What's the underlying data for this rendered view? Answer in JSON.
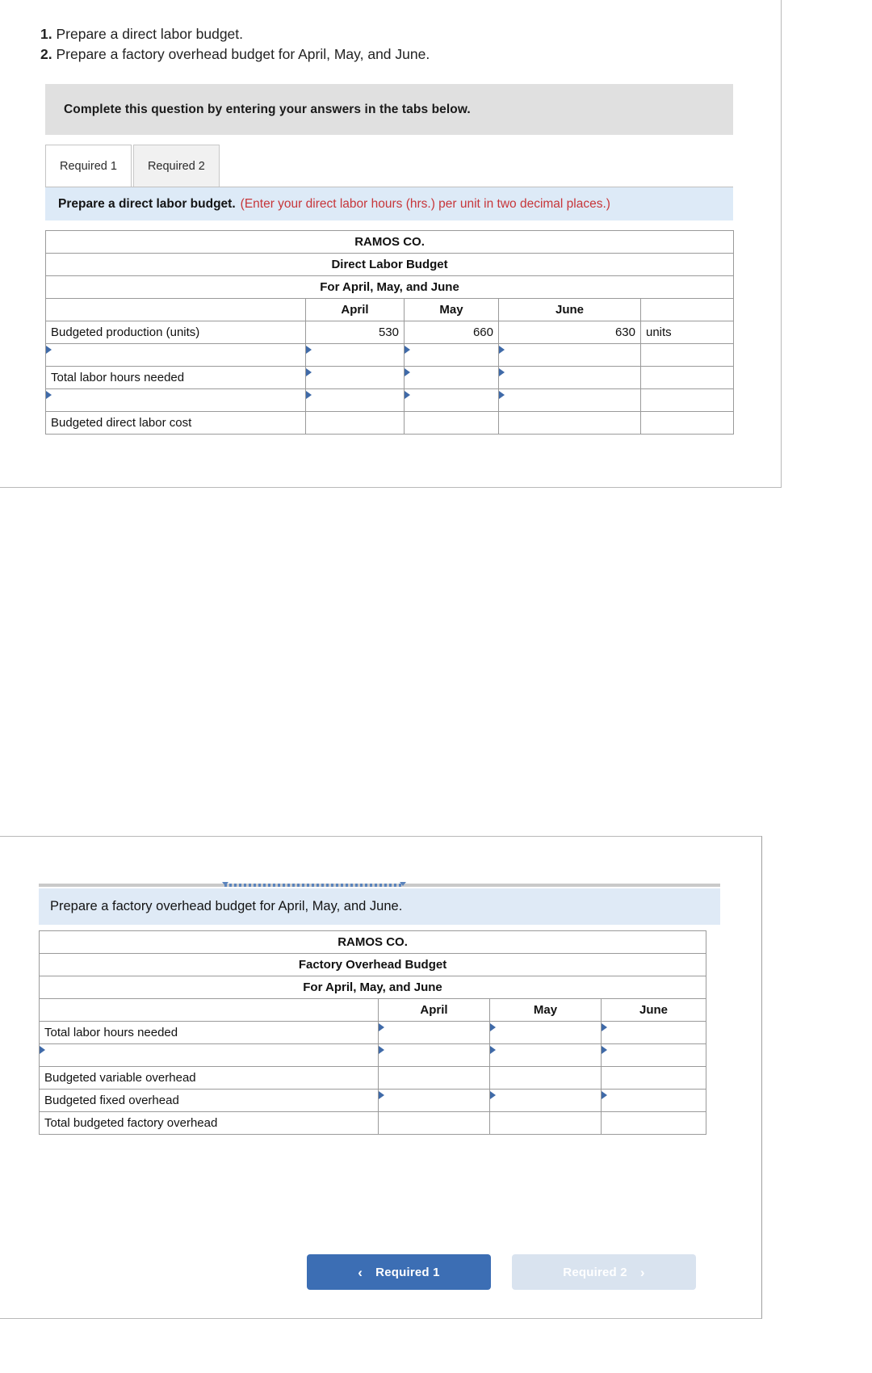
{
  "questions": [
    {
      "num": "1.",
      "text": "Prepare a direct labor budget."
    },
    {
      "num": "2.",
      "text": "Prepare a factory overhead budget for April, May, and June."
    }
  ],
  "gray_banner": {
    "text": "Complete this question by entering your answers in the tabs below."
  },
  "tabs": [
    {
      "label": "Required 1",
      "active": true
    },
    {
      "label": "Required 2",
      "active": false
    }
  ],
  "required1": {
    "instruction_main": "Prepare a direct labor budget.",
    "instruction_note": "(Enter your direct labor hours (hrs.) per unit in two decimal places.)",
    "table": {
      "title_lines": [
        "RAMOS CO.",
        "Direct Labor Budget",
        "For April, May, and June"
      ],
      "columns": [
        "",
        "April",
        "May",
        "June",
        ""
      ],
      "rows": [
        {
          "label": "Budgeted production (units)",
          "april": "530",
          "may": "660",
          "june": "630",
          "unit": "units",
          "kind": "value"
        },
        {
          "label": "",
          "april": "",
          "may": "",
          "june": "",
          "unit": "",
          "kind": "input"
        },
        {
          "label": "Total labor hours needed",
          "april": "",
          "may": "",
          "june": "",
          "unit": "",
          "kind": "input"
        },
        {
          "label": "",
          "april": "",
          "may": "",
          "june": "",
          "unit": "",
          "kind": "input"
        },
        {
          "label": "Budgeted direct labor cost",
          "april": "",
          "may": "",
          "june": "",
          "unit": "",
          "kind": "total"
        }
      ]
    }
  },
  "required2": {
    "instruction_main": "Prepare a factory overhead budget for April, May, and June.",
    "table": {
      "title_lines": [
        "RAMOS CO.",
        "Factory Overhead Budget",
        "For April, May, and June"
      ],
      "columns": [
        "",
        "April",
        "May",
        "June"
      ],
      "rows": [
        {
          "label": "Total labor hours needed",
          "april": "",
          "may": "",
          "june": "",
          "kind": "input"
        },
        {
          "label": "",
          "april": "",
          "may": "",
          "june": "",
          "kind": "input"
        },
        {
          "label": "Budgeted variable overhead",
          "april": "",
          "may": "",
          "june": "",
          "kind": "plain"
        },
        {
          "label": "Budgeted fixed overhead",
          "april": "",
          "may": "",
          "june": "",
          "kind": "input"
        },
        {
          "label": "Total budgeted factory overhead",
          "april": "",
          "may": "",
          "june": "",
          "kind": "total"
        }
      ]
    }
  },
  "nav": {
    "prev_label": "Required 1",
    "prev_icon": "chevron-left-icon",
    "next_label": "Required 2",
    "next_icon": "chevron-right-icon"
  },
  "colors": {
    "table_header_blue": "#7fa8d8",
    "instruction_blue": "#ddeaf7",
    "banner_gray": "#e0e0e0",
    "input_border": "#5b84bd",
    "total_yellow": "#fbf7c4",
    "note_red": "#c7363a",
    "button_blue": "#3c6eb4",
    "button_disabled": "#d9e3ef"
  }
}
